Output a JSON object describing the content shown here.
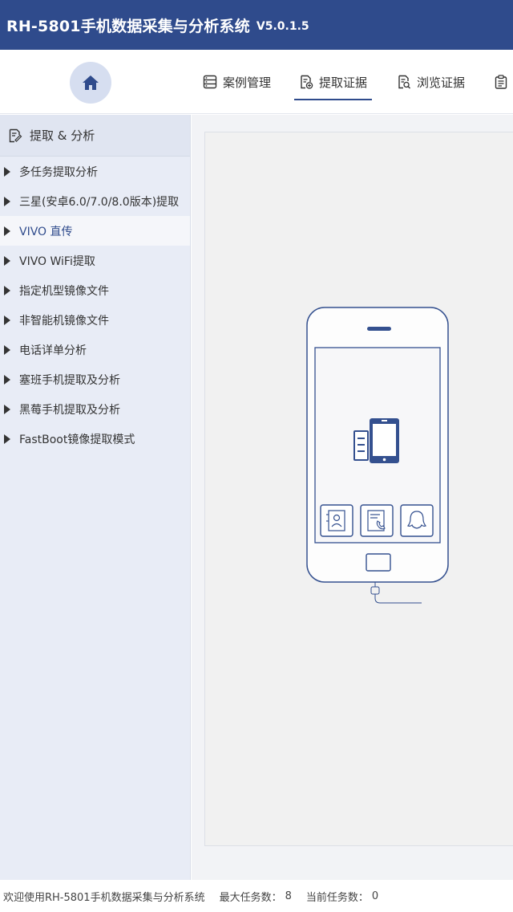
{
  "app": {
    "title": "RH-5801手机数据采集与分析系统",
    "version": "V5.0.1.5"
  },
  "nav": {
    "home_icon": "home-icon",
    "tabs": [
      {
        "label": "案例管理",
        "icon": "case-list-icon",
        "active": false
      },
      {
        "label": "提取证据",
        "icon": "extract-evidence-icon",
        "active": true
      },
      {
        "label": "浏览证据",
        "icon": "browse-evidence-icon",
        "active": false
      },
      {
        "label": "",
        "icon": "clipboard-icon",
        "active": false
      }
    ]
  },
  "sidebar": {
    "header": "提取 & 分析",
    "items": [
      {
        "label": "多任务提取分析",
        "active": false
      },
      {
        "label": "三星(安卓6.0/7.0/8.0版本)提取",
        "active": false
      },
      {
        "label": "VIVO 直传",
        "active": true
      },
      {
        "label": "VIVO WiFi提取",
        "active": false
      },
      {
        "label": "指定机型镜像文件",
        "active": false
      },
      {
        "label": "非智能机镜像文件",
        "active": false
      },
      {
        "label": "电话详单分析",
        "active": false
      },
      {
        "label": "塞班手机提取及分析",
        "active": false
      },
      {
        "label": "黑莓手机提取及分析",
        "active": false
      },
      {
        "label": "FastBoot镜像提取模式",
        "active": false
      }
    ]
  },
  "illustration": {
    "icons": [
      "phone-transfer-icon",
      "contacts-icon",
      "call-log-icon",
      "qq-icon",
      "usb-plug-icon"
    ]
  },
  "status": {
    "welcome": "欢迎使用RH-5801手机数据采集与分析系统",
    "max_tasks_label": "最大任务数：",
    "max_tasks_value": "8",
    "current_tasks_label": "当前任务数：",
    "current_tasks_value": "0"
  },
  "colors": {
    "brand": "#2f4b8c",
    "sidebar_bg": "#e8ecf6",
    "home_circle": "#d6def0"
  }
}
